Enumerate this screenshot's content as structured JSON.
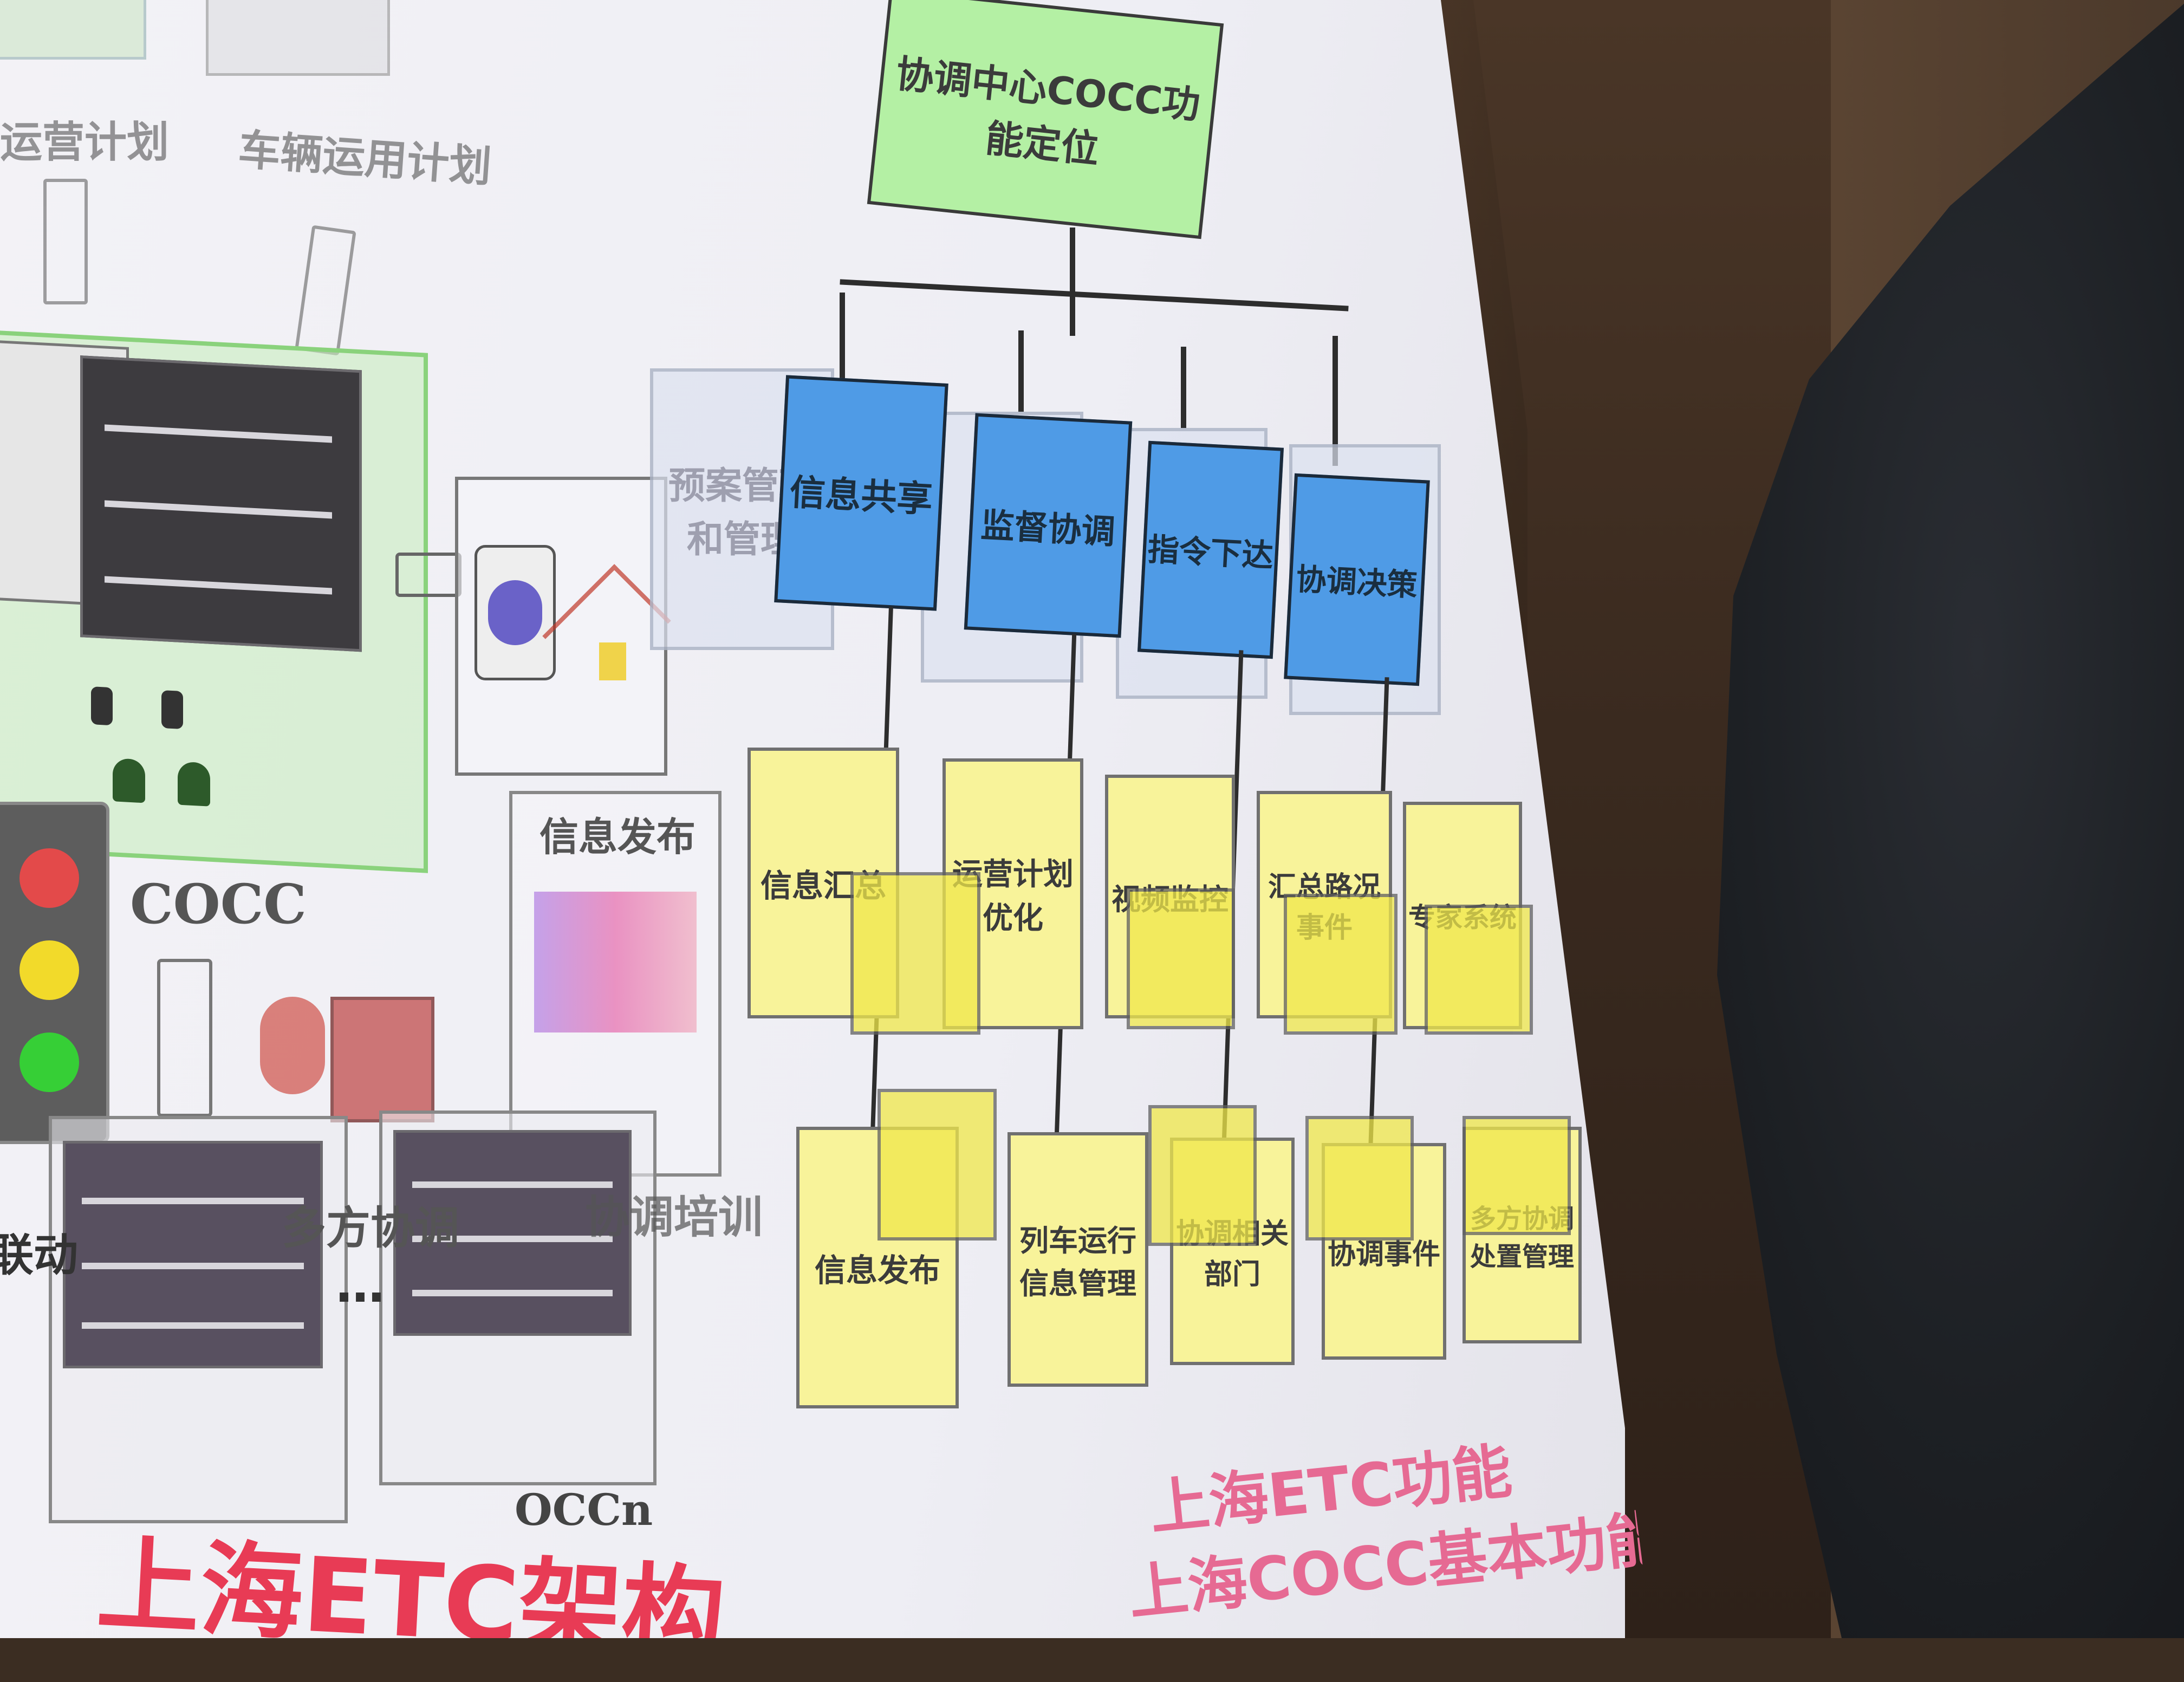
{
  "diagram": {
    "root": "协调中心COCC功能定位",
    "level2": [
      "信息共享",
      "监督协调",
      "指令下达",
      "协调决策"
    ],
    "faint_left": "预案管理和管理",
    "level3_top": [
      "信息汇总",
      "运营计划优化",
      "视频监控",
      "汇总路况事件",
      "专家系统"
    ],
    "level3_bottom": [
      "信息发布",
      "列车运行信息管理",
      "协调相关部门",
      "协调事件",
      "多方协调处置管理"
    ]
  },
  "left_panel": {
    "plan1": "运营计划",
    "plan2": "车辆运用计划",
    "cocc_label": "COCC",
    "info_release": "信息发布",
    "occn": "OCCn",
    "bottom_left_text": "联动",
    "bottom_mid_text": "多方协调",
    "bottom_right_text": "协调培训",
    "ellipsis": "…"
  },
  "titles": {
    "left_red": "上海ETC架构",
    "right_pink_1": "上海ETC功能",
    "right_pink_2": "上海COCC基本功能"
  }
}
